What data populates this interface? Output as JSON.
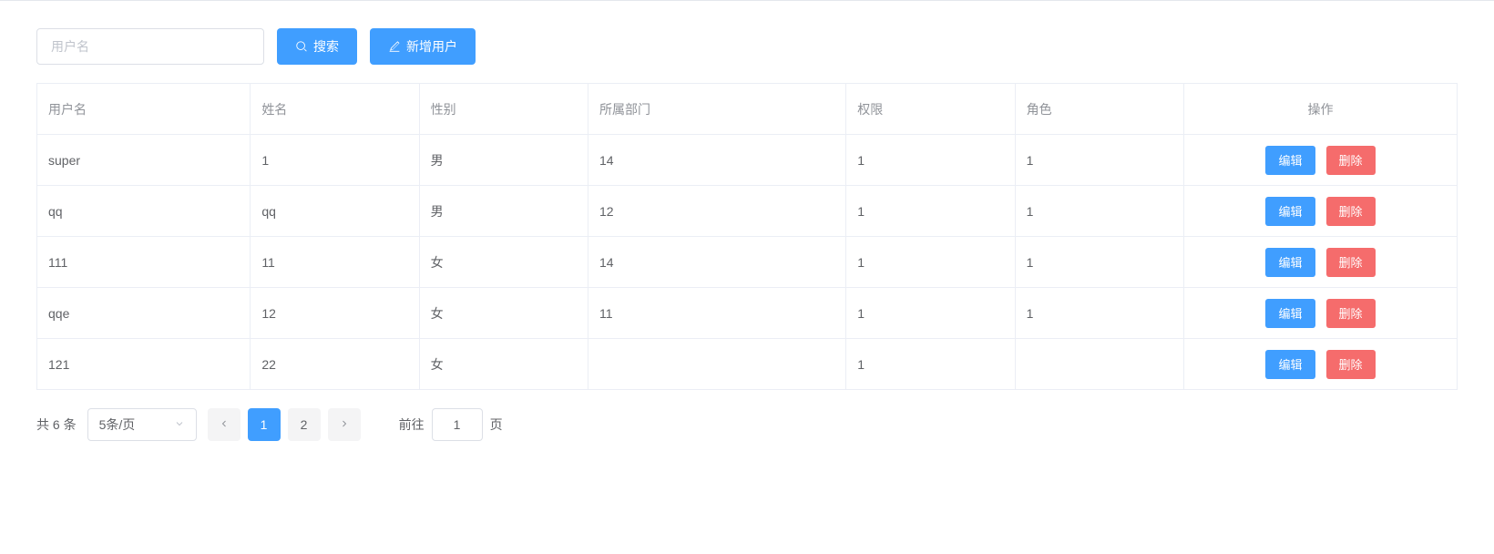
{
  "toolbar": {
    "search_placeholder": "用户名",
    "search_button": "搜索",
    "add_button": "新增用户"
  },
  "table": {
    "headers": {
      "username": "用户名",
      "name": "姓名",
      "gender": "性别",
      "department": "所属部门",
      "permission": "权限",
      "role": "角色",
      "operation": "操作"
    },
    "edit_label": "编辑",
    "delete_label": "删除",
    "rows": [
      {
        "username": "super",
        "name": "1",
        "gender": "男",
        "department": "14",
        "permission": "1",
        "role": "1"
      },
      {
        "username": "qq",
        "name": "qq",
        "gender": "男",
        "department": "12",
        "permission": "1",
        "role": "1"
      },
      {
        "username": "111",
        "name": "11",
        "gender": "女",
        "department": "14",
        "permission": "1",
        "role": "1"
      },
      {
        "username": "qqe",
        "name": "12",
        "gender": "女",
        "department": "11",
        "permission": "1",
        "role": "1"
      },
      {
        "username": "121",
        "name": "22",
        "gender": "女",
        "department": "",
        "permission": "1",
        "role": ""
      }
    ]
  },
  "pagination": {
    "total_text": "共 6 条",
    "page_size_label": "5条/页",
    "pages": [
      "1",
      "2"
    ],
    "current_page": 1,
    "goto_prefix": "前往",
    "goto_value": "1",
    "goto_suffix": "页"
  }
}
